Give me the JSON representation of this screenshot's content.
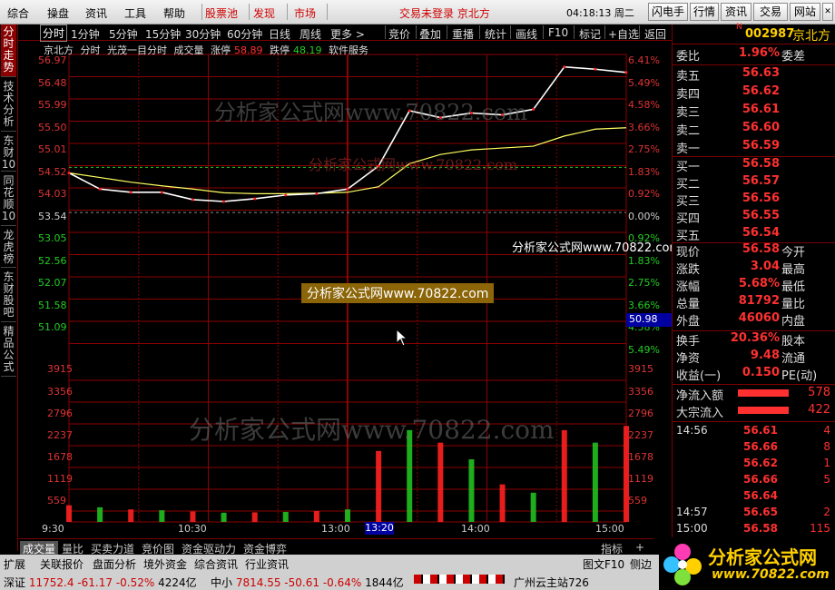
{
  "menu": {
    "items": [
      "综合",
      "操盘",
      "资讯",
      "工具",
      "帮助"
    ],
    "red_items": [
      "股票池",
      "发现",
      "市场"
    ],
    "center_text": "交易未登录 京北方",
    "clock": "04:18:13 周二",
    "right_buttons": [
      "闪电手",
      "行情",
      "资讯",
      "交易",
      "网站"
    ]
  },
  "toolbar": {
    "periods": [
      "分时",
      "1分钟",
      "5分钟",
      "15分钟",
      "30分钟",
      "60分钟",
      "日线",
      "周线",
      "更多 >"
    ],
    "tools": [
      "竞价",
      "叠加",
      "重播",
      "统计",
      "画线",
      "F10",
      "标记",
      "+自选",
      "返回"
    ]
  },
  "left_tabs": [
    "分时走势",
    "技术分析",
    "东财10",
    "同花顺10",
    "龙虎榜",
    "东财股吧",
    "精品公式"
  ],
  "chart": {
    "info": {
      "name": "京北方",
      "mode": "分时",
      "indicator": "光茂一目分时",
      "vol_label": "成交量",
      "up_label": "涨停",
      "up_val": "58.89",
      "down_label": "跌停",
      "down_val": "48.19",
      "sector": "软件服务"
    },
    "price_labels": [
      "56.97",
      "56.48",
      "55.99",
      "55.50",
      "55.01",
      "54.52",
      "54.03",
      "53.54",
      "53.05",
      "52.56",
      "52.07",
      "51.58",
      "51.09"
    ],
    "pct_labels": [
      "6.41%",
      "5.49%",
      "4.58%",
      "3.66%",
      "2.75%",
      "1.83%",
      "0.92%",
      "0.00%",
      "0.92%",
      "1.83%",
      "2.75%",
      "3.66%",
      "4.58%",
      "5.49%"
    ],
    "vol_labels": [
      "3915",
      "3356",
      "2796",
      "2237",
      "1678",
      "1119",
      "559"
    ],
    "time_labels": [
      "9:30",
      "10:30",
      "13:00",
      "14:00",
      "15:00"
    ],
    "hover_price": "50.98",
    "hover_time": "13:20",
    "watermark": "分析家公式网www.70822.com",
    "colors": {
      "up": "#ff2020",
      "down": "#20c020",
      "price_line": "#ffffff",
      "avg_line": "#ffff60",
      "grid": "#8b0000"
    }
  },
  "chart_data": {
    "type": "line",
    "title": "京北方 分时",
    "xlabel": "",
    "ylabel": "",
    "ylim": [
      50.57,
      56.97
    ],
    "prev_close": 53.54,
    "x": [
      "09:30",
      "09:45",
      "10:00",
      "10:15",
      "10:30",
      "10:45",
      "11:00",
      "11:15",
      "11:30/13:00",
      "13:15",
      "13:20",
      "13:30",
      "13:45",
      "14:00",
      "14:15",
      "14:30",
      "14:45",
      "14:57",
      "15:00"
    ],
    "series": [
      {
        "name": "price",
        "values": [
          54.4,
          54.05,
          53.98,
          53.98,
          53.82,
          53.78,
          53.84,
          53.92,
          53.95,
          54.05,
          54.55,
          55.75,
          55.6,
          55.7,
          55.66,
          55.78,
          56.7,
          56.65,
          56.58
        ]
      },
      {
        "name": "avg",
        "values": [
          54.4,
          54.3,
          54.2,
          54.12,
          54.05,
          53.97,
          53.95,
          53.95,
          53.96,
          53.98,
          54.1,
          54.6,
          54.8,
          54.9,
          54.94,
          54.98,
          55.2,
          55.35,
          55.38
        ]
      }
    ],
    "volume_ylim": [
      0,
      3915
    ],
    "volume": [
      400,
      350,
      300,
      280,
      250,
      220,
      230,
      240,
      260,
      300,
      1700,
      2200,
      1900,
      1500,
      900,
      700,
      2200,
      1900,
      2300
    ]
  },
  "right_panel": {
    "code": "002987",
    "name": "京北方",
    "wei_label": "委比",
    "wei_val": "1.96%",
    "wei_diff_label": "委差",
    "asks": [
      {
        "l": "卖五",
        "p": "56.63"
      },
      {
        "l": "卖四",
        "p": "56.62"
      },
      {
        "l": "卖三",
        "p": "56.61"
      },
      {
        "l": "卖二",
        "p": "56.60"
      },
      {
        "l": "卖一",
        "p": "56.59"
      }
    ],
    "bids": [
      {
        "l": "买一",
        "p": "56.58"
      },
      {
        "l": "买二",
        "p": "56.57"
      },
      {
        "l": "买三",
        "p": "56.56"
      },
      {
        "l": "买四",
        "p": "56.55"
      },
      {
        "l": "买五",
        "p": "56.54"
      }
    ],
    "stats": [
      {
        "l": "现价",
        "v": "56.58",
        "l2": "今开"
      },
      {
        "l": "涨跌",
        "v": "3.04",
        "l2": "最高"
      },
      {
        "l": "涨幅",
        "v": "5.68%",
        "l2": "最低"
      },
      {
        "l": "总量",
        "v": "81792",
        "l2": "量比"
      },
      {
        "l": "外盘",
        "v": "46060",
        "l2": "内盘"
      }
    ],
    "stats2": [
      {
        "l": "换手",
        "v": "20.36%",
        "l2": "股本"
      },
      {
        "l": "净资",
        "v": "9.48",
        "l2": "流通"
      },
      {
        "l": "收益(一)",
        "v": "0.150",
        "l2": "PE(动)"
      }
    ],
    "flows": [
      {
        "l": "净流入额",
        "v": "578"
      },
      {
        "l": "大宗流入",
        "v": "422"
      }
    ],
    "ticks": [
      {
        "t": "14:56",
        "p": "56.61",
        "v": "4"
      },
      {
        "t": "",
        "p": "56.66",
        "v": "8"
      },
      {
        "t": "",
        "p": "56.62",
        "v": "1"
      },
      {
        "t": "",
        "p": "56.66",
        "v": "5"
      },
      {
        "t": "",
        "p": "56.64",
        "v": ""
      },
      {
        "t": "14:57",
        "p": "56.65",
        "v": "2"
      },
      {
        "t": "15:00",
        "p": "56.58",
        "v": "115"
      }
    ]
  },
  "bottom_tabs": [
    "成交量",
    "量比",
    "买卖力道",
    "竞价图",
    "资金驱动力",
    "资金博弈"
  ],
  "bottom_right": [
    "指标",
    "+"
  ],
  "status_tabs": [
    "扩展",
    "关联报价",
    "盘面分析",
    "境外资金",
    "综合资讯",
    "行业资讯"
  ],
  "status_right": [
    "图文F10",
    "侧边"
  ],
  "indices": [
    {
      "name": "深证",
      "v": "11752.4",
      "chg": "-61.17",
      "pct": "-0.52%",
      "amt": "4224亿"
    },
    {
      "name": "中小",
      "v": "7814.55",
      "chg": "-50.61",
      "pct": "-0.64%",
      "amt": "1844亿"
    }
  ],
  "server": "广州云主站726",
  "logo": {
    "title": "分析家公式网",
    "url": "www.70822.com"
  }
}
